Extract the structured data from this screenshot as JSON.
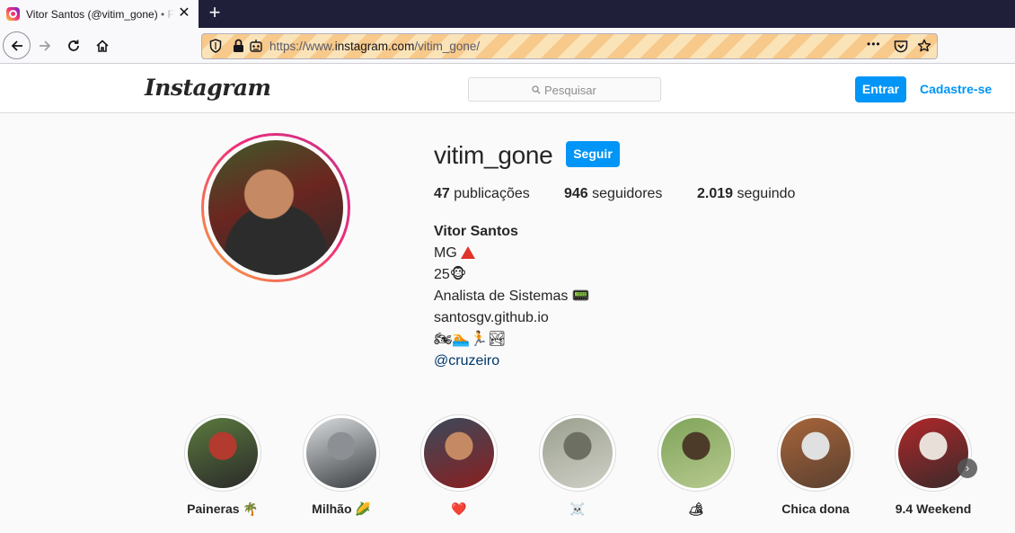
{
  "browser": {
    "tab_title": "Vitor Santos (@vitim_gone) • Fotos e vídeos do Instagram",
    "tab_close": "✕",
    "new_tab": "+",
    "url_prefix": "https://www.",
    "url_host": "instagram.com",
    "url_path": "/vitim_gone/",
    "menu_dots": "•••"
  },
  "header": {
    "logo": "Instagram",
    "search_placeholder": "Pesquisar",
    "login_label": "Entrar",
    "signup_label": "Cadastre-se"
  },
  "profile": {
    "username": "vitim_gone",
    "follow_label": "Seguir",
    "stats": {
      "posts_count": "47",
      "posts_label": "publicações",
      "followers_count": "946",
      "followers_label": "seguidores",
      "following_count": "2.019",
      "following_label": "seguindo"
    },
    "bio": {
      "name": "Vitor Santos",
      "line1": "MG",
      "line2": "25🐵",
      "line3": "Analista de Sistemas 📟",
      "line4": "santosgv.github.io",
      "line5": "🏍🏊🏃🏞",
      "mention": "@cruzeiro"
    }
  },
  "highlights": [
    {
      "label": "Paineras 🌴",
      "colors": [
        "#5b7a3e",
        "#b33a2e",
        "#2a2a2a"
      ]
    },
    {
      "label": "Milhão 🌽",
      "colors": [
        "#d9dcdf",
        "#8c9094",
        "#3a3d40"
      ]
    },
    {
      "label": "❤️",
      "colors": [
        "#3a4a5c",
        "#c58a63",
        "#8a1f1f"
      ]
    },
    {
      "label": "☠️",
      "colors": [
        "#9aa08f",
        "#6d6f63",
        "#cfcfc6"
      ]
    },
    {
      "label": "🏕",
      "colors": [
        "#7fa45a",
        "#4d3b2a",
        "#b7c98f"
      ]
    },
    {
      "label": "Chica dona",
      "colors": [
        "#a8653a",
        "#e0e0e0",
        "#5a4030"
      ]
    },
    {
      "label": "9.4 Weekend",
      "colors": [
        "#b0272a",
        "#e8e0d8",
        "#3a2a2a"
      ]
    }
  ],
  "highlights_next": "›"
}
